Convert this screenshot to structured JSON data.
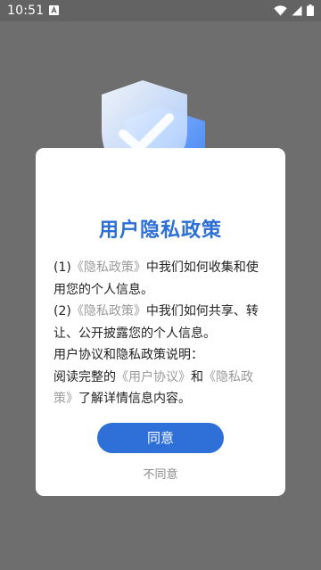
{
  "status_bar": {
    "time": "10:51",
    "icons": [
      "notification-a-icon",
      "wifi-icon",
      "signal-icon",
      "battery-icon"
    ]
  },
  "dialog": {
    "title": "用户隐私政策",
    "paragraphs": [
      {
        "prefix": "(1)",
        "link": "《隐私政策》",
        "text": "中我们如何收集和使用您的个人信息。"
      },
      {
        "prefix": "(2)",
        "link": "《隐私政策》",
        "text": "中我们如何共享、转让、公开披露您的个人信息。"
      },
      {
        "heading": "用户协议和隐私政策说明："
      },
      {
        "prefix": "阅读完整的",
        "link1": "《用户协议》",
        "mid": "和",
        "link2": "《隐私政策》",
        "suffix": "了解详情信息内容。"
      }
    ],
    "agree_label": "同意",
    "disagree_label": "不同意"
  },
  "colors": {
    "accent": "#2e6fd8",
    "title": "#2b6fd6",
    "link": "#9a9a9a",
    "overlay": "#6e6e6e"
  }
}
